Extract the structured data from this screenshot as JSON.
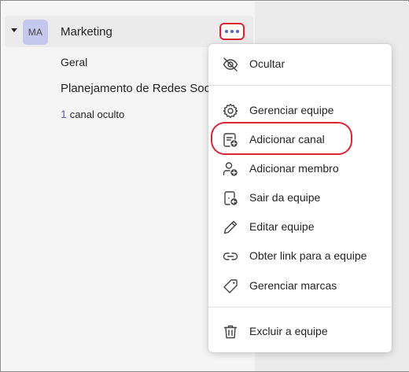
{
  "team": {
    "initials": "MA",
    "name": "Marketing",
    "more_options_label": "•••"
  },
  "channels": [
    {
      "name": "Geral"
    },
    {
      "name": "Planejamento de Redes Sociais"
    }
  ],
  "hidden_channels": {
    "count": "1",
    "label": "canal oculto"
  },
  "menu": {
    "items": [
      {
        "label": "Ocultar",
        "icon": "eye-off-icon"
      },
      {
        "label": "Gerenciar equipe",
        "icon": "gear-icon"
      },
      {
        "label": "Adicionar canal",
        "icon": "add-channel-icon"
      },
      {
        "label": "Adicionar membro",
        "icon": "add-member-icon"
      },
      {
        "label": "Sair da equipe",
        "icon": "leave-team-icon"
      },
      {
        "label": "Editar equipe",
        "icon": "pencil-icon"
      },
      {
        "label": "Obter link para a equipe",
        "icon": "link-icon"
      },
      {
        "label": "Gerenciar marcas",
        "icon": "tag-icon"
      },
      {
        "label": "Excluir a equipe",
        "icon": "trash-icon"
      }
    ]
  },
  "colors": {
    "accent": "#5b5fc7",
    "highlight": "#d92635",
    "avatar_bg": "#c5c8ee"
  }
}
